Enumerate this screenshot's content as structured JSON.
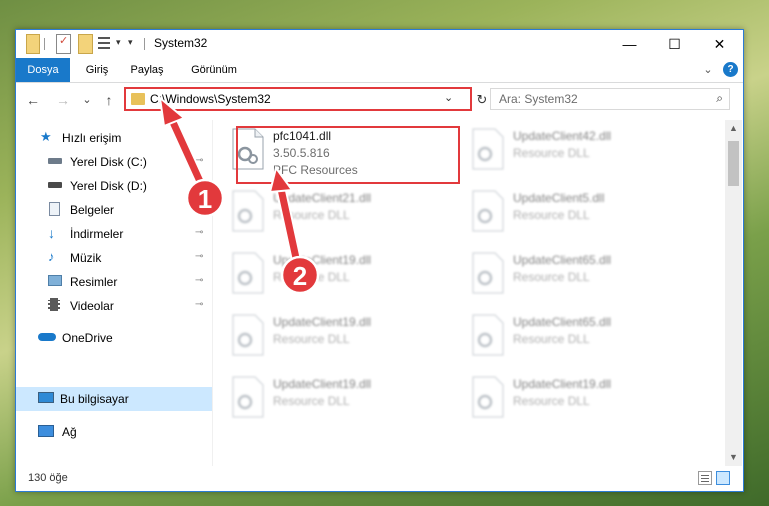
{
  "window": {
    "title": "System32",
    "controls": {
      "minimize": "—",
      "maximize": "☐",
      "close": "✕"
    }
  },
  "ribbon": {
    "tabs": [
      {
        "label": "Dosya"
      },
      {
        "label": "Giriş"
      },
      {
        "label": "Paylaş"
      },
      {
        "label": "Görünüm"
      }
    ],
    "expand_glyph": "⌄",
    "help_glyph": "?"
  },
  "navigation": {
    "back": "←",
    "forward": "→",
    "recent": "⌄",
    "up": "↑",
    "address": "C:\\Windows\\System32",
    "address_dropdown": "⌄",
    "refresh": "↻",
    "search_placeholder": "Ara: System32",
    "search_icon": "⌕"
  },
  "sidebar": {
    "items": [
      {
        "label": "Hızlı erişim",
        "icon": "star-icon",
        "pinned": false
      },
      {
        "label": "Yerel Disk (C:)",
        "icon": "drive-icon",
        "pinned": true
      },
      {
        "label": "Yerel Disk (D:)",
        "icon": "drive-icon",
        "pinned": false
      },
      {
        "label": "Belgeler",
        "icon": "documents-icon",
        "pinned": false
      },
      {
        "label": "İndirmeler",
        "icon": "downloads-icon",
        "pinned": true
      },
      {
        "label": "Müzik",
        "icon": "music-icon",
        "pinned": true
      },
      {
        "label": "Resimler",
        "icon": "pictures-icon",
        "pinned": true
      },
      {
        "label": "Videolar",
        "icon": "videos-icon",
        "pinned": true
      },
      {
        "label": "OneDrive",
        "icon": "cloud-icon",
        "pinned": false
      },
      {
        "label": "Bu bilgisayar",
        "icon": "computer-icon",
        "pinned": false,
        "selected": true
      },
      {
        "label": "Ağ",
        "icon": "network-icon",
        "pinned": false
      }
    ],
    "pin_glyph": "📌"
  },
  "files": {
    "highlighted": {
      "name": "pfc1041.dll",
      "version": "3.50.5.816",
      "description": "PFC Resources"
    },
    "tiles": [
      {
        "name": "UpdateClient42.dll",
        "description": "Resource DLL"
      },
      {
        "name": "UpdateClient21.dll",
        "description": "Resource DLL"
      },
      {
        "name": "UpdateClient5.dll",
        "description": "Resource DLL"
      },
      {
        "name": "UpdateClient19.dll",
        "description": "Resource DLL"
      },
      {
        "name": "UpdateClient65.dll",
        "description": "Resource DLL"
      },
      {
        "name": "UpdateClient19.dll",
        "description": "Resource DLL"
      },
      {
        "name": "UpdateClient65.dll",
        "description": "Resource DLL"
      },
      {
        "name": "UpdateClient19.dll",
        "description": "Resource DLL"
      },
      {
        "name": "UpdateClient19.dll",
        "description": "Resource DLL"
      }
    ]
  },
  "statusbar": {
    "item_count": "130 öğe"
  },
  "annotations": {
    "badge1": "1",
    "badge2": "2",
    "accent_color": "#e2393c"
  }
}
